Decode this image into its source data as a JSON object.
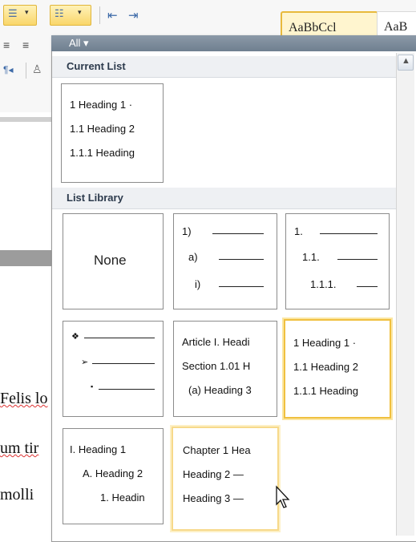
{
  "panel": {
    "all_label": "All ▾",
    "sections": {
      "current": "Current List",
      "library": "List Library"
    }
  },
  "current_list": [
    "1 Heading 1 ·",
    "1.1 Heading 2",
    "1.1.1 Heading"
  ],
  "library": {
    "none_label": "None",
    "numbered": [
      "1)",
      "a)",
      "i)"
    ],
    "decimal": [
      "1.",
      "1.1.",
      "1.1.1."
    ],
    "bullets": [
      "❖",
      "➢",
      "▪"
    ],
    "article": [
      "Article I. Headi",
      "Section 1.01 H",
      "(a) Heading 3"
    ],
    "heading_numbered": [
      "1 Heading 1 ·",
      "1.1 Heading 2",
      "1.1.1 Heading"
    ],
    "roman": [
      "I. Heading 1",
      "A. Heading 2",
      "1. Headin"
    ],
    "chapter": [
      "Chapter 1 Hea",
      "Heading 2 —",
      "Heading 3 —"
    ]
  },
  "document_fragments": [
    "Felis lo",
    "um tir",
    "molli"
  ],
  "ribbon": {
    "style_preview": "AaBbCcl",
    "style_preview2": "AaB"
  },
  "colors": {
    "selected_border": "#f0c040",
    "header_bar": "#7b8a99"
  }
}
